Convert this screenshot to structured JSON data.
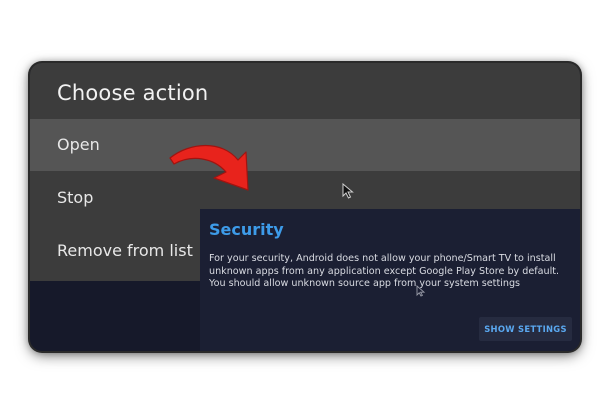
{
  "action_menu": {
    "title": "Choose action",
    "items": [
      {
        "label": "Open",
        "focused": true
      },
      {
        "label": "Stop",
        "focused": false
      },
      {
        "label": "Remove from list",
        "focused": false
      }
    ]
  },
  "security_dialog": {
    "title": "Security",
    "message_lines": [
      "For your security, Android does not allow your phone/Smart TV to install unknown apps from any application except Google Play Store by default.",
      "You should allow unknown source app from your system settings"
    ],
    "button_label": "SHOW SETTINGS"
  },
  "icons": {
    "cursor": "mouse-pointer-icon",
    "annotation": "red-arrow-icon"
  },
  "colors": {
    "menu_background": "#3c3c3c",
    "menu_focused": "#555555",
    "dialog_background": "#1b1f33",
    "dialog_title": "#3d9be9",
    "button_text": "#5aa8f0",
    "arrow": "#e8231c"
  }
}
